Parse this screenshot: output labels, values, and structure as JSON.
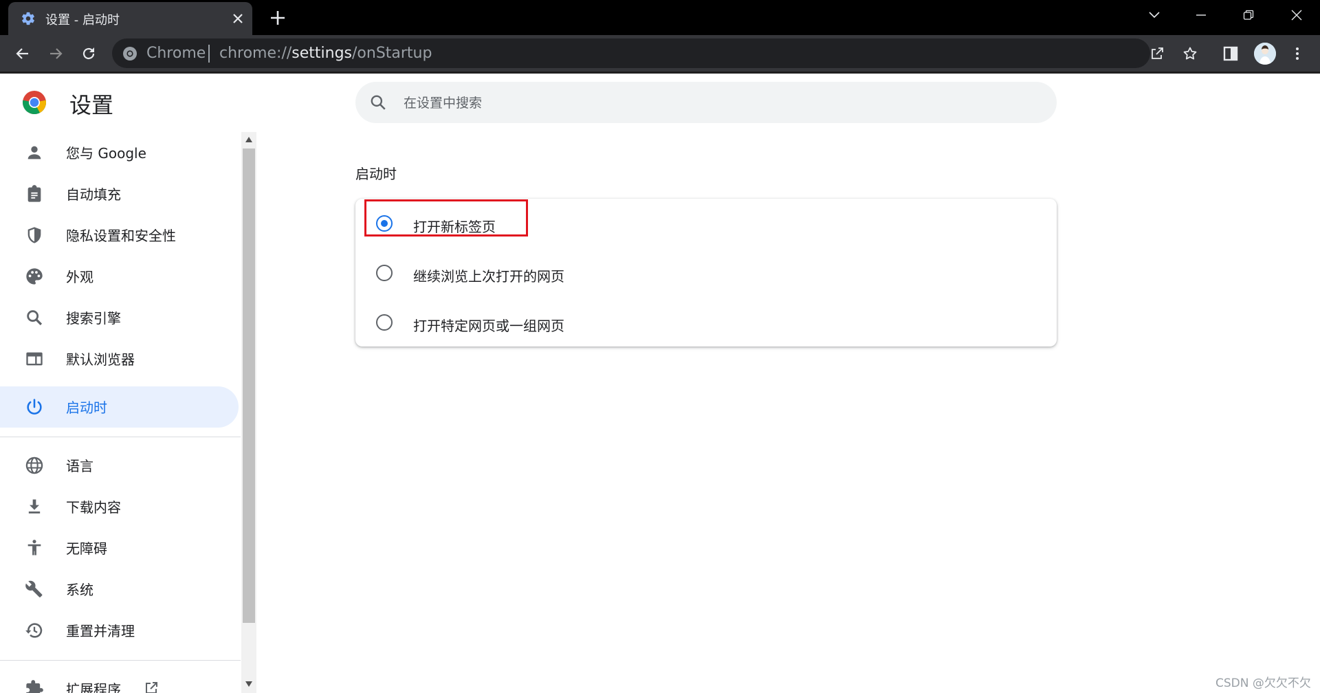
{
  "browser": {
    "tab": {
      "title": "设置 - 启动时"
    },
    "omnibox": {
      "site_chip": "Chrome",
      "url_scheme": "chrome://",
      "url_host": "settings",
      "url_path": "/onStartup"
    }
  },
  "settings": {
    "title": "设置",
    "search": {
      "placeholder": "在设置中搜索"
    },
    "sidebar": {
      "items": [
        {
          "label": "您与 Google",
          "icon": "person-icon"
        },
        {
          "label": "自动填充",
          "icon": "clipboard-icon"
        },
        {
          "label": "隐私设置和安全性",
          "icon": "shield-icon"
        },
        {
          "label": "外观",
          "icon": "palette-icon"
        },
        {
          "label": "搜索引擎",
          "icon": "search-icon"
        },
        {
          "label": "默认浏览器",
          "icon": "browser-window-icon"
        },
        {
          "label": "启动时",
          "icon": "power-icon",
          "active": true
        },
        {
          "label": "语言",
          "icon": "globe-icon"
        },
        {
          "label": "下载内容",
          "icon": "download-icon"
        },
        {
          "label": "无障碍",
          "icon": "accessibility-icon"
        },
        {
          "label": "系统",
          "icon": "wrench-icon"
        },
        {
          "label": "重置并清理",
          "icon": "history-icon"
        },
        {
          "label": "扩展程序",
          "icon": "puzzle-icon"
        }
      ]
    },
    "startup": {
      "section_title": "启动时",
      "options": [
        {
          "label": "打开新标签页",
          "checked": true
        },
        {
          "label": "继续浏览上次打开的网页",
          "checked": false
        },
        {
          "label": "打开特定网页或一组网页",
          "checked": false
        }
      ]
    }
  },
  "watermark": "CSDN @欠欠不欠",
  "colors": {
    "accent": "#1a73e8",
    "active_nav_bg": "#e8f0fe",
    "highlight_box": "#e1141e",
    "titlebar_bg": "#000000",
    "toolbar_bg": "#35363a"
  }
}
